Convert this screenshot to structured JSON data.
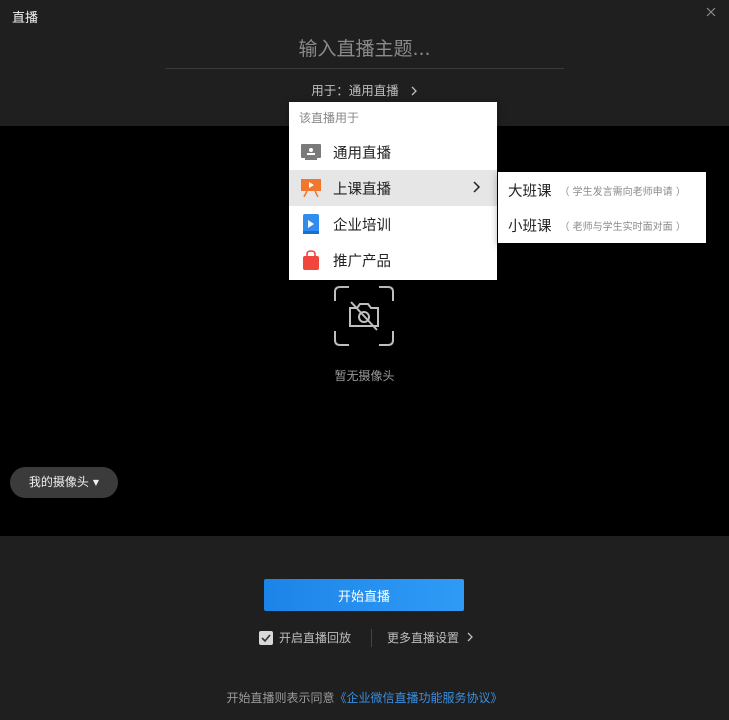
{
  "window": {
    "title": "直播"
  },
  "topic": {
    "placeholder": "输入直播主题..."
  },
  "usage": {
    "label": "用于：通用直播"
  },
  "menu": {
    "header": "该直播用于",
    "items": [
      {
        "label": "通用直播",
        "icon": "monitor-icon",
        "color": "#7a7a7a"
      },
      {
        "label": "上课直播",
        "icon": "class-board-icon",
        "color": "#f0772d"
      },
      {
        "label": "企业培训",
        "icon": "training-book-icon",
        "color": "#2f8df0"
      },
      {
        "label": "推广产品",
        "icon": "shopping-bag-icon",
        "color": "#f0463c"
      }
    ]
  },
  "submenu": {
    "items": [
      {
        "title": "大班课",
        "desc": "（ 学生发言需向老师申请 ）"
      },
      {
        "title": "小班课",
        "desc": "（ 老师与学生实时面对面 ）"
      }
    ]
  },
  "preview": {
    "no_camera": "暂无摄像头",
    "my_camera": "我的摄像头"
  },
  "actions": {
    "start": "开始直播",
    "replay": "开启直播回放",
    "replay_checked": true,
    "more": "更多直播设置"
  },
  "agreement": {
    "prefix": "开始直播则表示同意",
    "link": "《企业微信直播功能服务协议》"
  },
  "colors": {
    "accent": "#1c84e8",
    "link": "#3a8fe3",
    "background": "#1f1f1f"
  }
}
